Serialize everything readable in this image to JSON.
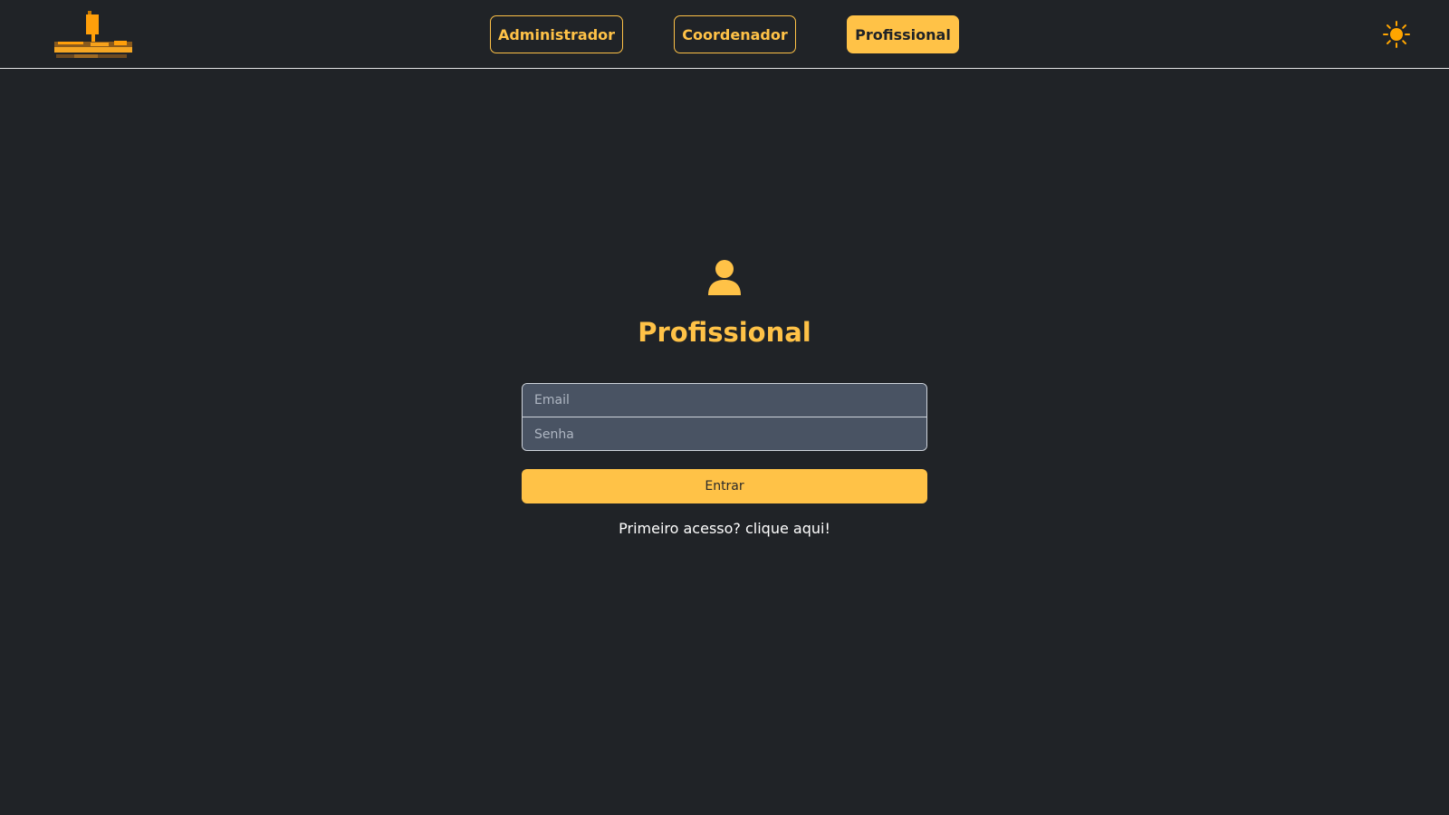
{
  "header": {
    "nav": {
      "admin_label": "Administrador",
      "coord_label": "Coordenador",
      "prof_label": "Profissional"
    },
    "theme_icon": "sun-icon"
  },
  "login": {
    "icon": "user-icon",
    "title": "Profissional",
    "email_placeholder": "Email",
    "password_placeholder": "Senha",
    "submit_label": "Entrar",
    "first_access_label": "Primeiro acesso? clique aqui!"
  },
  "colors": {
    "accent": "#ffc247",
    "background": "#202327",
    "input_bg": "#495363",
    "sun": "#ffa500"
  }
}
